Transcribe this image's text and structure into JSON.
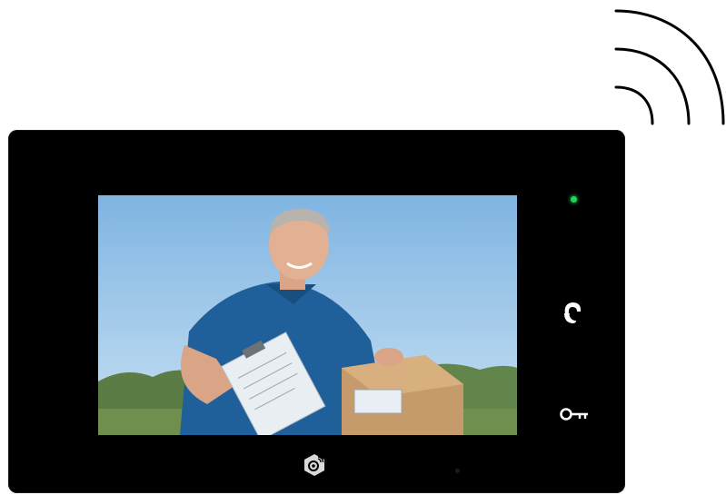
{
  "device": {
    "type": "video-door-phone-monitor",
    "bezel_color": "#000000",
    "status_led_color": "#26d05a"
  },
  "screen": {
    "content": "delivery-person-holding-clipboard-and-parcel",
    "sky_color": "#9cc8ec",
    "shirt_color": "#1f5f9a"
  },
  "controls": {
    "talk": {
      "icon": "handset-icon"
    },
    "unlock": {
      "icon": "key-icon"
    },
    "menu": {
      "icon": "settings-home-icon"
    }
  },
  "wireless": {
    "icon": "wifi-signal-icon",
    "arcs": 3
  }
}
